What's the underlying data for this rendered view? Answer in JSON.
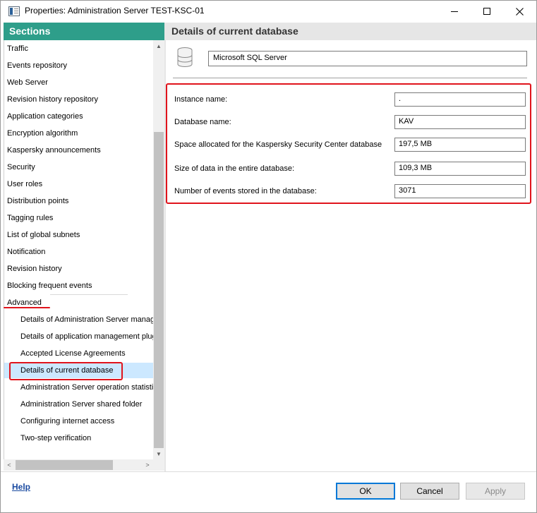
{
  "window": {
    "title": "Properties: Administration Server TEST-KSC-01"
  },
  "sidebar": {
    "header": "Sections",
    "items": [
      {
        "label": "Traffic",
        "level": 0
      },
      {
        "label": "Events repository",
        "level": 0
      },
      {
        "label": "Web Server",
        "level": 0
      },
      {
        "label": "Revision history repository",
        "level": 0
      },
      {
        "label": "Application categories",
        "level": 0
      },
      {
        "label": "Encryption algorithm",
        "level": 0
      },
      {
        "label": "Kaspersky announcements",
        "level": 0
      },
      {
        "label": "Security",
        "level": 0
      },
      {
        "label": "User roles",
        "level": 0
      },
      {
        "label": "Distribution points",
        "level": 0
      },
      {
        "label": "Tagging rules",
        "level": 0
      },
      {
        "label": "List of global subnets",
        "level": 0
      },
      {
        "label": "Notification",
        "level": 0
      },
      {
        "label": "Revision history",
        "level": 0
      },
      {
        "label": "Blocking frequent events",
        "level": 0
      },
      {
        "label": "Advanced",
        "level": 0
      },
      {
        "label": "Details of Administration Server manag",
        "level": 1
      },
      {
        "label": "Details of application management plug",
        "level": 1
      },
      {
        "label": "Accepted License Agreements",
        "level": 1
      },
      {
        "label": "Details of current database",
        "level": 1,
        "selected": true
      },
      {
        "label": "Administration Server operation statisti",
        "level": 1
      },
      {
        "label": "Administration Server shared folder",
        "level": 1
      },
      {
        "label": "Configuring internet access",
        "level": 1
      },
      {
        "label": "Two-step verification",
        "level": 1
      }
    ]
  },
  "main": {
    "header": "Details of current database",
    "database_type": "Microsoft SQL Server",
    "fields": [
      {
        "label": "Instance name:",
        "value": "."
      },
      {
        "label": "Database name:",
        "value": "KAV"
      },
      {
        "label": "Space allocated for the Kaspersky Security Center database",
        "value": "197,5 MB"
      },
      {
        "label": "Size of data in the entire database:",
        "value": "109,3 MB"
      },
      {
        "label": "Number of events stored in the database:",
        "value": "3071"
      }
    ]
  },
  "footer": {
    "help": "Help",
    "ok": "OK",
    "cancel": "Cancel",
    "apply": "Apply"
  },
  "colors": {
    "sections_header_bg": "#2e9e8a",
    "selection_bg": "#cce8ff",
    "highlight_red": "#e0141c",
    "ok_border": "#0078d7"
  }
}
